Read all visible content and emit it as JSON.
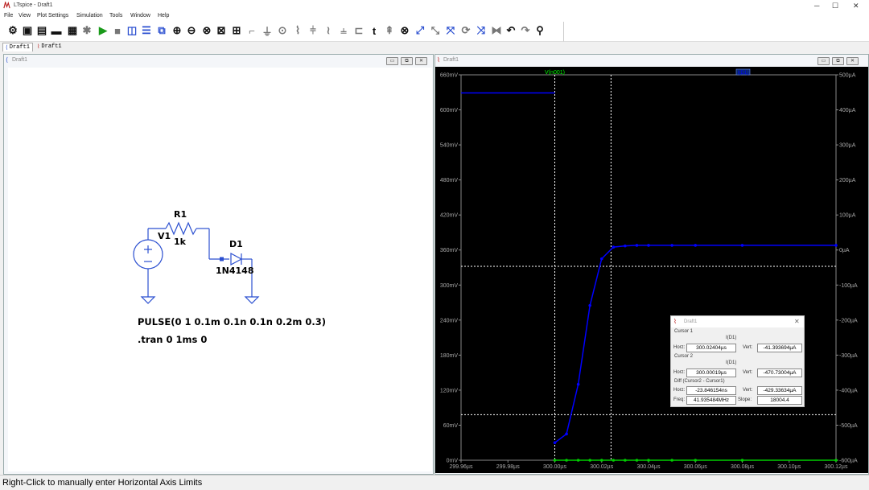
{
  "window": {
    "title": "LTspice - Draft1",
    "min": "─",
    "max": "☐",
    "close": "✕"
  },
  "menu": [
    "File",
    "View",
    "Plot Settings",
    "Simulation",
    "Tools",
    "Window",
    "Help"
  ],
  "tabs": [
    "Draft1",
    "Draft1"
  ],
  "schematic": {
    "title": "Draft1",
    "r1_name": "R1",
    "r1_value": "1k",
    "v1_name": "V1",
    "d1_name": "D1",
    "d1_value": "1N4148",
    "pulse": "PULSE(0 1 0.1m 0.1n 0.1n 0.2m 0.3)",
    "tran": ".tran 0 1ms 0"
  },
  "plot": {
    "title": "Draft1",
    "trace_v": "V(n001)",
    "trace_i": "I(D1)",
    "colors": {
      "v_trace": "#0000ff",
      "i_trace": "#00cc00",
      "background": "#000000",
      "v_label": "#00ff00"
    }
  },
  "chart_data": {
    "type": "line",
    "title": "",
    "x_tick_labels": [
      "299.96µs",
      "299.98µs",
      "300.00µs",
      "300.02µs",
      "300.04µs",
      "300.06µs",
      "300.08µs",
      "300.10µs",
      "300.12µs"
    ],
    "y_left_tick_labels": [
      "660mV",
      "600mV",
      "540mV",
      "480mV",
      "420mV",
      "360mV",
      "300mV",
      "240mV",
      "180mV",
      "120mV",
      "60mV",
      "0mV"
    ],
    "y_right_tick_labels": [
      "500µA",
      "400µA",
      "300µA",
      "200µA",
      "100µA",
      "0µA",
      "-100µA",
      "-200µA",
      "-300µA",
      "-400µA",
      "-500µA",
      "-600µA"
    ],
    "xlim": [
      299.96,
      300.12
    ],
    "ylim_left_mV": [
      0,
      660
    ],
    "ylim_right_uA": [
      -600,
      500
    ],
    "series": [
      {
        "name": "V(n001)",
        "axis": "left",
        "x_us": [
          299.96,
          300.0,
          300.0,
          300.005,
          300.01,
          300.015,
          300.02,
          300.025,
          300.03,
          300.035,
          300.04,
          300.05,
          300.06,
          300.08,
          300.12
        ],
        "y_mV": [
          629,
          629,
          30,
          45,
          130,
          265,
          345,
          365,
          367,
          368,
          368,
          368,
          368,
          368,
          368
        ]
      },
      {
        "name": "I(D1)",
        "axis": "right",
        "x_us": [
          300.0,
          300.005,
          300.01,
          300.015,
          300.02,
          300.025,
          300.03,
          300.035,
          300.04,
          300.05,
          300.06,
          300.08,
          300.12
        ],
        "y_uA": [
          -600,
          -600,
          -600,
          -600,
          -600,
          -600,
          -600,
          -600,
          -600,
          -600,
          -600,
          -600,
          -600
        ]
      }
    ],
    "cursors": {
      "cursor1_x_us": 300.024,
      "cursor1_y_mV": 332,
      "cursor2_x_us": 300.0,
      "cursor2_y_mV": 78
    }
  },
  "cursor_dialog": {
    "title": "Draft1",
    "cursor1_label": "Cursor 1",
    "cursor1_trace": "I(D1)",
    "horz_label": "Horz:",
    "vert_label": "Vert:",
    "cursor1_horz": "300.02404µs",
    "cursor1_vert": "-41.393694µA",
    "cursor2_label": "Cursor 2",
    "cursor2_trace": "I(D1)",
    "cursor2_horz": "300.00019µs",
    "cursor2_vert": "-470.73004µA",
    "diff_label": "Diff (Cursor2 - Cursor1)",
    "diff_horz": "-23.846154ns",
    "diff_vert": "-429.33634µA",
    "freq_label": "Freq:",
    "slope_label": "Slope:",
    "freq": "41.935484MHz",
    "slope": "18004.4"
  },
  "status": "Right-Click to manually enter Horizontal Axis Limits"
}
